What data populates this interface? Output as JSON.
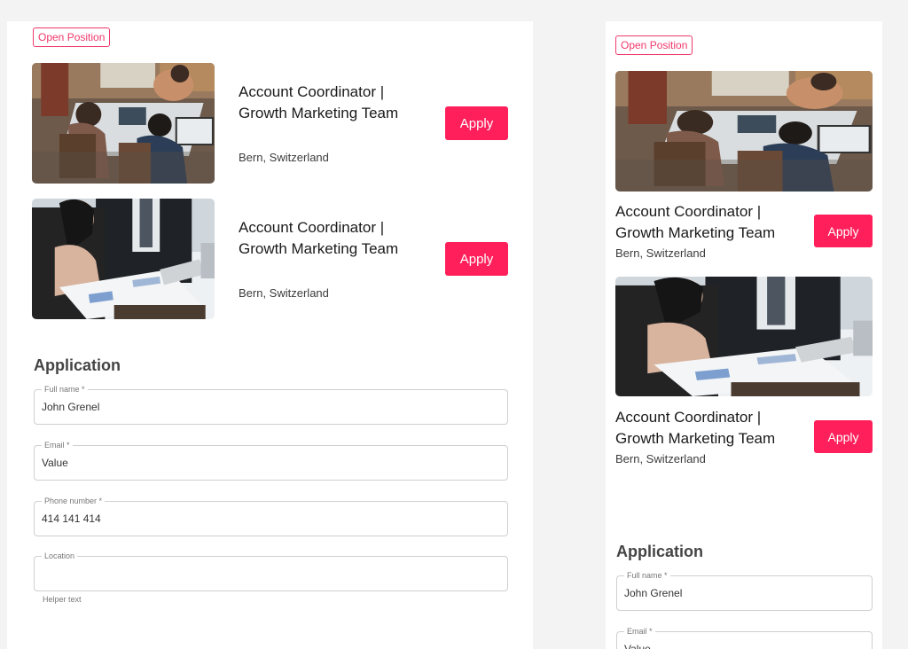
{
  "open_position_label": "Open Position",
  "jobs": [
    {
      "title_line1": "Account Coordinator |",
      "title_line2": "Growth Marketing Team",
      "location": "Bern, Switzerland",
      "apply_label": "Apply",
      "image": "coworkers-at-laptops-photo"
    },
    {
      "title_line1": "Account Coordinator |",
      "title_line2": "Growth Marketing Team",
      "location": "Bern, Switzerland",
      "apply_label": "Apply",
      "image": "business-meeting-documents-photo"
    }
  ],
  "application": {
    "title": "Application",
    "fields": [
      {
        "label": "Full name *",
        "value": "John Grenel"
      },
      {
        "label": "Email *",
        "value": "Value"
      },
      {
        "label": "Phone number *",
        "value": "414 141 414"
      },
      {
        "label": "Location",
        "value": "",
        "helper": "Helper text"
      }
    ]
  },
  "colors": {
    "accent": "#ff1f5a",
    "badge": "#f0386b",
    "page_bg": "#f3f3f3",
    "card_bg": "#ffffff"
  }
}
